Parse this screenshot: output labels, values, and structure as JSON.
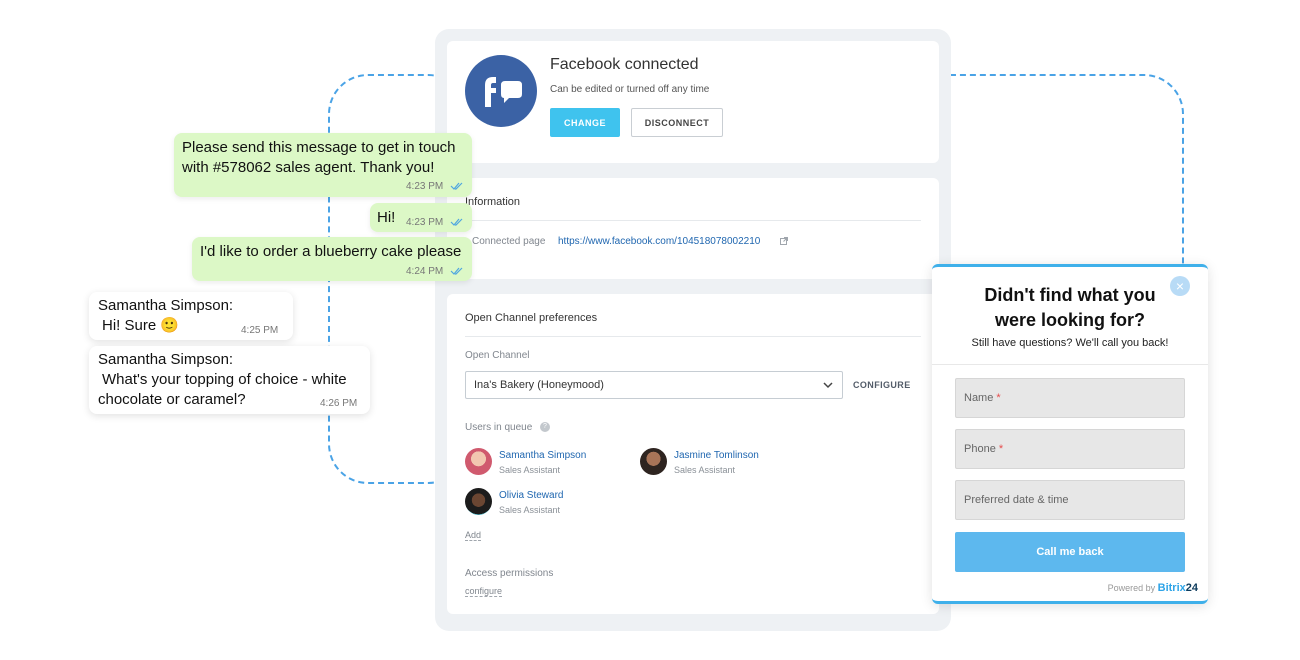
{
  "facebook": {
    "title": "Facebook connected",
    "subtitle": "Can be edited or turned off any time",
    "change_label": "CHANGE",
    "disconnect_label": "DISCONNECT"
  },
  "information": {
    "heading": "Information",
    "connected_page_label": "Connected page",
    "connected_page_url": "https://www.facebook.com/104518078002210"
  },
  "preferences": {
    "heading": "Open Channel preferences",
    "channel_label": "Open Channel",
    "channel_value": "Ina's Bakery (Honeymood)",
    "configure_label": "CONFIGURE",
    "queue_label": "Users in queue",
    "users": [
      {
        "name": "Samantha Simpson",
        "role": "Sales Assistant"
      },
      {
        "name": "Jasmine Tomlinson",
        "role": "Sales Assistant"
      },
      {
        "name": "Olivia Steward",
        "role": "Sales Assistant"
      }
    ],
    "add_label": "Add",
    "access_label": "Access permissions",
    "access_link": "configure"
  },
  "chat": {
    "messages": [
      {
        "direction": "out",
        "text1": "Please send this message to get in touch",
        "text2": "with #578062 sales agent. Thank you!",
        "time": "4:23 PM"
      },
      {
        "direction": "out",
        "text": "Hi!",
        "time": "4:23 PM"
      },
      {
        "direction": "out",
        "text": "I'd like to order a blueberry cake please",
        "time": "4:24 PM"
      },
      {
        "direction": "in",
        "sender": "Samantha Simpson:",
        "text": "Hi! Sure 🙂",
        "time": "4:25 PM"
      },
      {
        "direction": "in",
        "sender": "Samantha Simpson:",
        "text1": "What's your topping of choice - white",
        "text2": "chocolate or caramel?",
        "time": "4:26 PM"
      }
    ]
  },
  "widget": {
    "title1": "Didn't find what you",
    "title2": "were looking for?",
    "subtitle": "Still have questions? We'll call you back!",
    "name_placeholder": "Name",
    "phone_placeholder": "Phone",
    "datetime_placeholder": "Preferred date & time",
    "required_mark": "*",
    "button_label": "Call me back",
    "powered_by": "Powered by",
    "brand": "Bitrix",
    "brand_num": "24",
    "close_glyph": "×"
  },
  "colors": {
    "accent": "#3fc3ee",
    "facebook_blue": "#3b62a5",
    "outgoing_bubble": "#dcf8c6",
    "link": "#2067b0"
  }
}
